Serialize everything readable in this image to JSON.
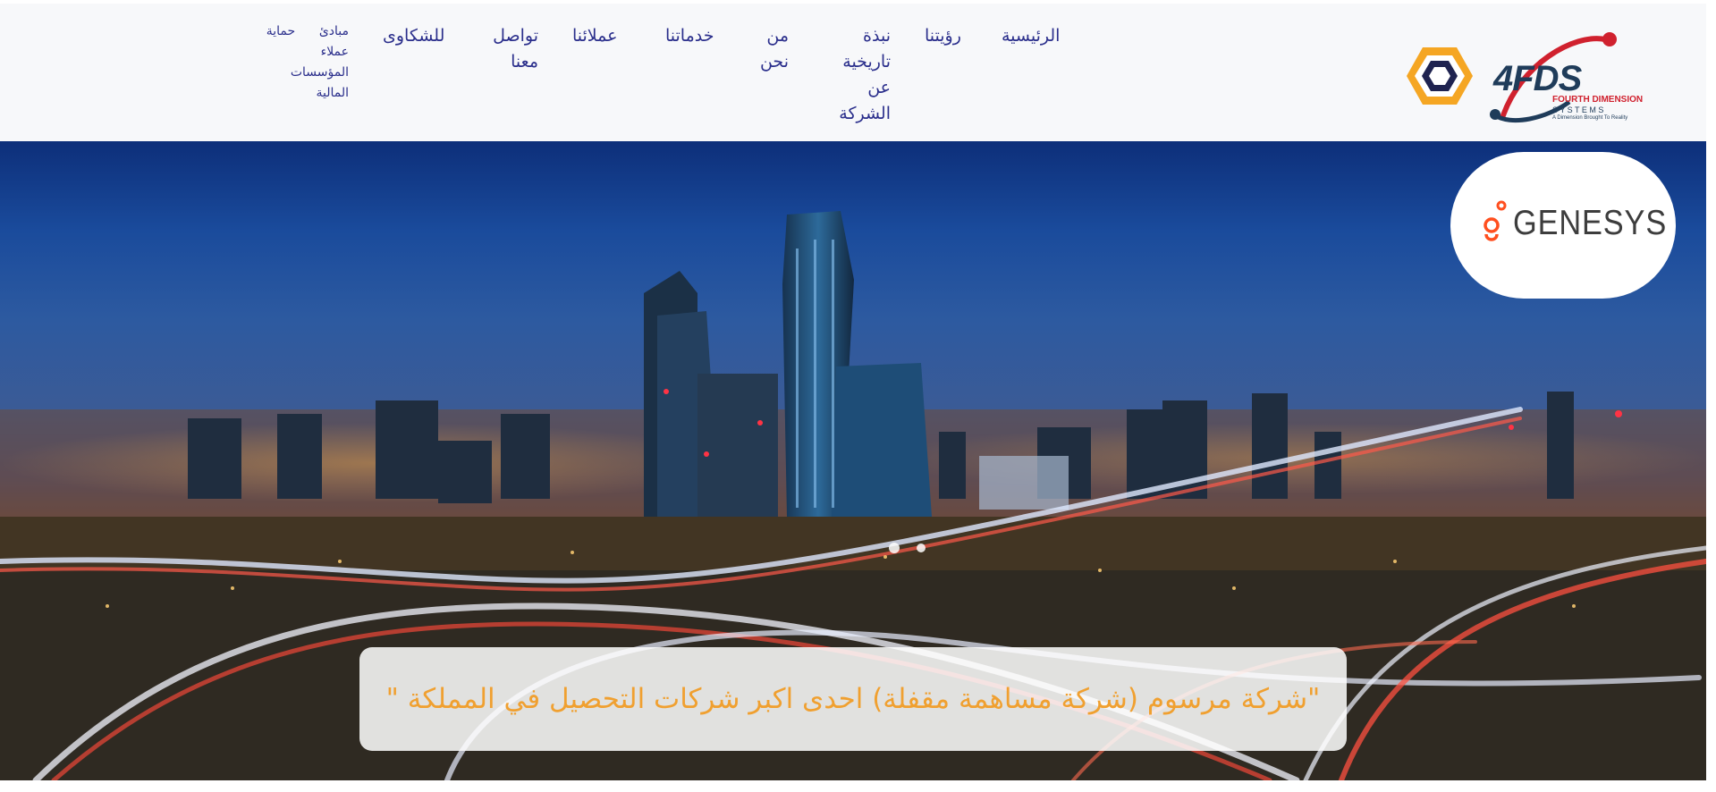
{
  "nav": {
    "home": "الرئيسية",
    "vision": "رؤيتنا",
    "history_line1": "نبذة",
    "history_line2": "تاريخية",
    "history_line3": "عن",
    "history_line4": "الشركة",
    "about_line1": "من",
    "about_line2": "نحن",
    "services": "خدماتنا",
    "clients": "عملائنا",
    "contact_line1": "تواصل",
    "contact_line2": "معنا",
    "complaints": "للشكاوى",
    "principles_line1": "مبادئ",
    "principles_line2": "حماية",
    "principles_line3": "عملاء",
    "principles_line4": "المؤسسات",
    "principles_line5": "المالية"
  },
  "logos": {
    "fds_mark": "4FDS",
    "fds_name": "FOURTH DIMENSION",
    "fds_systems": "S Y S T E M S",
    "fds_tagline": "A Dimension Brought To Reality",
    "partner": "GENESYS"
  },
  "hero": {
    "quote": "\"شركة مرسوم (شركة مساهمة مقفلة) احدى اكبر شركات التحصيل في المملكة \""
  },
  "colors": {
    "nav_text": "#2b2f8c",
    "quote_text": "#f0a030",
    "hex_orange": "#f5a623",
    "hex_navy": "#1f2350",
    "fds_red": "#d0212e",
    "genesys_red": "#ff4f1f"
  }
}
